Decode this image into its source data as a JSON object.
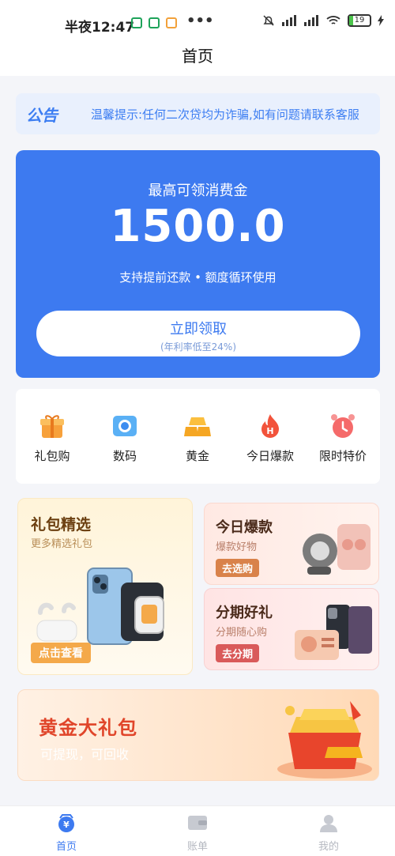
{
  "status_bar": {
    "time": "半夜12:47",
    "more": "•••",
    "battery": "19"
  },
  "nav": {
    "title": "首页"
  },
  "notice": {
    "tag": "公告",
    "text": "温馨提示:任何二次贷均为诈骗,如有问题请联系客服"
  },
  "hero": {
    "title": "最高可领消费金",
    "amount": "1500.0",
    "subtitle": "支持提前还款 • 额度循环使用",
    "button_label": "立即领取",
    "button_note": "(年利率低至24%)"
  },
  "categories": [
    {
      "label": "礼包购",
      "icon": "gift-icon"
    },
    {
      "label": "数码",
      "icon": "camera-icon"
    },
    {
      "label": "黄金",
      "icon": "gold-bars-icon"
    },
    {
      "label": "今日爆款",
      "icon": "fire-icon"
    },
    {
      "label": "限时特价",
      "icon": "alarm-clock-icon"
    }
  ],
  "promos": {
    "gift_select": {
      "title": "礼包精选",
      "subtitle": "更多精选礼包",
      "button": "点击查看"
    },
    "hot_today": {
      "title": "今日爆款",
      "subtitle": "爆款好物",
      "button": "去选购"
    },
    "installment": {
      "title": "分期好礼",
      "subtitle": "分期随心购",
      "button": "去分期"
    },
    "gold_pack": {
      "title": "黄金大礼包",
      "subtitle": "可提现，可回收"
    }
  },
  "tabs": [
    {
      "label": "首页",
      "icon": "home-yen-icon",
      "active": true
    },
    {
      "label": "账单",
      "icon": "bill-icon",
      "active": false
    },
    {
      "label": "我的",
      "icon": "user-icon",
      "active": false
    }
  ],
  "colors": {
    "primary": "#3d7af0",
    "tab_active": "#3d7af0",
    "tab_inactive": "#b5b8c0"
  }
}
